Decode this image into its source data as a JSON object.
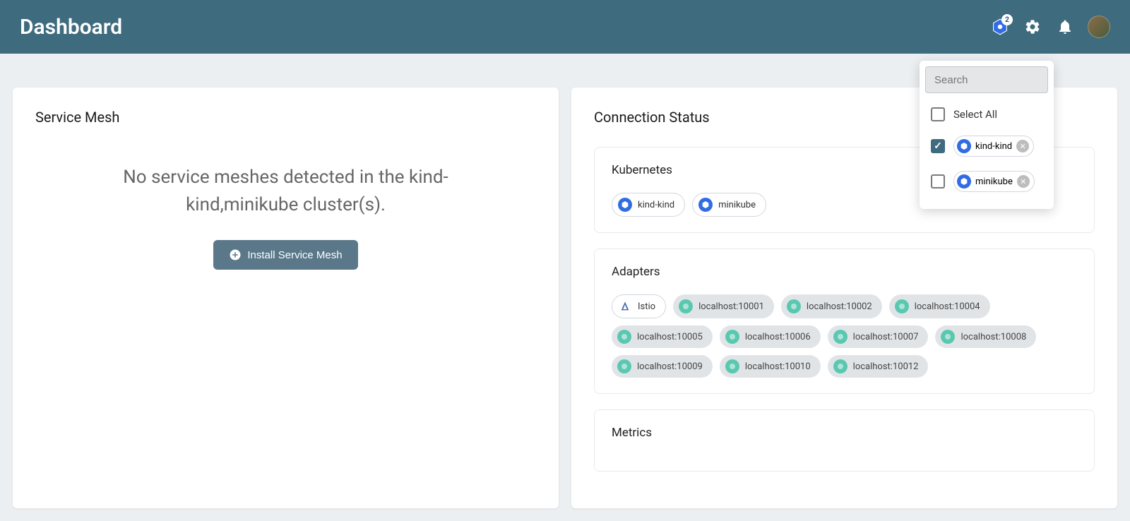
{
  "header": {
    "title": "Dashboard",
    "cluster_badge": "2"
  },
  "service_mesh": {
    "title": "Service Mesh",
    "empty_message": "No service meshes detected in the kind-kind,minikube cluster(s).",
    "install_label": "Install Service Mesh"
  },
  "connection_status": {
    "title": "Connection Status",
    "kubernetes": {
      "title": "Kubernetes",
      "clusters": [
        "kind-kind",
        "minikube"
      ]
    },
    "adapters": {
      "title": "Adapters",
      "istio_label": "Istio",
      "items": [
        "localhost:10001",
        "localhost:10002",
        "localhost:10004",
        "localhost:10005",
        "localhost:10006",
        "localhost:10007",
        "localhost:10008",
        "localhost:10009",
        "localhost:10010",
        "localhost:10012"
      ]
    },
    "metrics": {
      "title": "Metrics"
    }
  },
  "dropdown": {
    "search_placeholder": "Search",
    "select_all": "Select All",
    "options": [
      {
        "label": "kind-kind",
        "checked": true
      },
      {
        "label": "minikube",
        "checked": false
      }
    ]
  }
}
